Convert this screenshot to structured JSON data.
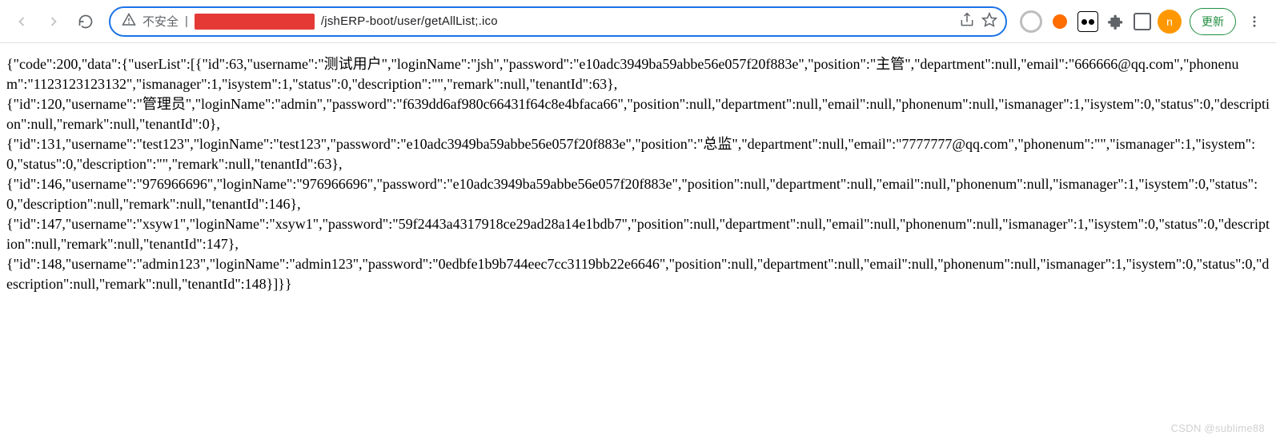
{
  "toolbar": {
    "insecure_label": "不安全",
    "url_visible": "/jshERP-boot/user/getAllList;.ico",
    "update_label": "更新",
    "avatar_letter": "n"
  },
  "response": {
    "code": 200,
    "data": {
      "userList": [
        {
          "id": 63,
          "username": "测试用户",
          "loginName": "jsh",
          "password": "e10adc3949ba59abbe56e057f20f883e",
          "position": "主管",
          "department": null,
          "email": "666666@qq.com",
          "phonenum": "1123123123132",
          "ismanager": 1,
          "isystem": 1,
          "status": 0,
          "description": "",
          "remark": null,
          "tenantId": 63
        },
        {
          "id": 120,
          "username": "管理员",
          "loginName": "admin",
          "password": "f639dd6af980c66431f64c8e4bfaca66",
          "position": null,
          "department": null,
          "email": null,
          "phonenum": null,
          "ismanager": 1,
          "isystem": 0,
          "status": 0,
          "description": null,
          "remark": null,
          "tenantId": 0
        },
        {
          "id": 131,
          "username": "test123",
          "loginName": "test123",
          "password": "e10adc3949ba59abbe56e057f20f883e",
          "position": "总监",
          "department": null,
          "email": "7777777@qq.com",
          "phonenum": "",
          "ismanager": 1,
          "isystem": 0,
          "status": 0,
          "description": "",
          "remark": null,
          "tenantId": 63
        },
        {
          "id": 146,
          "username": "976966696",
          "loginName": "976966696",
          "password": "e10adc3949ba59abbe56e057f20f883e",
          "position": null,
          "department": null,
          "email": null,
          "phonenum": null,
          "ismanager": 1,
          "isystem": 0,
          "status": 0,
          "description": null,
          "remark": null,
          "tenantId": 146
        },
        {
          "id": 147,
          "username": "xsyw1",
          "loginName": "xsyw1",
          "password": "59f2443a4317918ce29ad28a14e1bdb7",
          "position": null,
          "department": null,
          "email": null,
          "phonenum": null,
          "ismanager": 1,
          "isystem": 0,
          "status": 0,
          "description": null,
          "remark": null,
          "tenantId": 147
        },
        {
          "id": 148,
          "username": "admin123",
          "loginName": "admin123",
          "password": "0edbfe1b9b744eec7cc3119bb22e6646",
          "position": null,
          "department": null,
          "email": null,
          "phonenum": null,
          "ismanager": 1,
          "isystem": 0,
          "status": 0,
          "description": null,
          "remark": null,
          "tenantId": 148
        }
      ]
    }
  },
  "response_text": "{\"code\":200,\"data\":{\"userList\":[{\"id\":63,\"username\":\"测试用户\",\"loginName\":\"jsh\",\"password\":\"e10adc3949ba59abbe56e057f20f883e\",\"position\":\"主管\",\"department\":null,\"email\":\"666666@qq.com\",\"phonenum\":\"1123123123132\",\"ismanager\":1,\"isystem\":1,\"status\":0,\"description\":\"\",\"remark\":null,\"tenantId\":63},\n{\"id\":120,\"username\":\"管理员\",\"loginName\":\"admin\",\"password\":\"f639dd6af980c66431f64c8e4bfaca66\",\"position\":null,\"department\":null,\"email\":null,\"phonenum\":null,\"ismanager\":1,\"isystem\":0,\"status\":0,\"description\":null,\"remark\":null,\"tenantId\":0},\n{\"id\":131,\"username\":\"test123\",\"loginName\":\"test123\",\"password\":\"e10adc3949ba59abbe56e057f20f883e\",\"position\":\"总监\",\"department\":null,\"email\":\"7777777@qq.com\",\"phonenum\":\"\",\"ismanager\":1,\"isystem\":0,\"status\":0,\"description\":\"\",\"remark\":null,\"tenantId\":63},\n{\"id\":146,\"username\":\"976966696\",\"loginName\":\"976966696\",\"password\":\"e10adc3949ba59abbe56e057f20f883e\",\"position\":null,\"department\":null,\"email\":null,\"phonenum\":null,\"ismanager\":1,\"isystem\":0,\"status\":0,\"description\":null,\"remark\":null,\"tenantId\":146},\n{\"id\":147,\"username\":\"xsyw1\",\"loginName\":\"xsyw1\",\"password\":\"59f2443a4317918ce29ad28a14e1bdb7\",\"position\":null,\"department\":null,\"email\":null,\"phonenum\":null,\"ismanager\":1,\"isystem\":0,\"status\":0,\"description\":null,\"remark\":null,\"tenantId\":147},\n{\"id\":148,\"username\":\"admin123\",\"loginName\":\"admin123\",\"password\":\"0edbfe1b9b744eec7cc3119bb22e6646\",\"position\":null,\"department\":null,\"email\":null,\"phonenum\":null,\"ismanager\":1,\"isystem\":0,\"status\":0,\"description\":null,\"remark\":null,\"tenantId\":148}]}}",
  "watermark": "CSDN @sublime88"
}
